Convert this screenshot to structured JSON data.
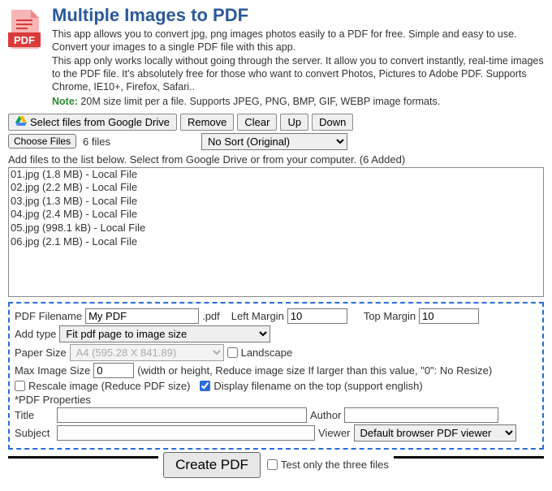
{
  "header": {
    "title": "Multiple Images to PDF",
    "desc1": "This app allows you to convert jpg, png images photos easily to a PDF for free. Simple and easy to use. Convert your images to a single PDF file with this app.",
    "desc2": "This app only works locally without going through the server. It allow you to convert instantly, real-time images to the PDF file. It's absolutely free for those who want to convert Photos, Pictures to Adobe PDF. Supports Chrome, IE10+, Firefox, Safari..",
    "note_label": "Note:",
    "note_text": " 20M size limit per a file. Supports JPEG, PNG, BMP, GIF, WEBP image formats."
  },
  "toolbar": {
    "gdrive": "Select files from Google Drive",
    "remove": "Remove",
    "clear": "Clear",
    "up": "Up",
    "down": "Down",
    "choose_files": "Choose Files",
    "file_count": "6 files",
    "sort_selected": "No Sort (Original)"
  },
  "instruction": "Add files to the list below. Select from Google Drive or from your computer. (6 Added)",
  "files": [
    "01.jpg (1.8 MB) - Local File",
    "02.jpg (2.2 MB) - Local File",
    "03.jpg (1.3 MB) - Local File",
    "04.jpg (2.4 MB) - Local File",
    "05.jpg (998.1 kB) - Local File",
    "06.jpg (2.1 MB) - Local File"
  ],
  "settings": {
    "filename_label": "PDF Filename",
    "filename_value": "My PDF",
    "ext": ".pdf",
    "left_margin_label": "Left Margin",
    "left_margin_value": "10",
    "top_margin_label": "Top Margin",
    "top_margin_value": "10",
    "addtype_label": "Add type",
    "addtype_value": "Fit pdf page to image size",
    "papersize_label": "Paper Size",
    "papersize_value": "A4 (595.28 X 841.89)",
    "landscape_label": "Landscape",
    "maxsize_label": "Max Image Size",
    "maxsize_value": "0",
    "maxsize_hint": "(width or height, Reduce image size If larger than this value, \"0\": No Resize)",
    "rescale_label": "Rescale image (Reduce PDF size)",
    "display_fname_label": "Display filename on the top (support english)",
    "props_label": "*PDF Properties",
    "title_label": "Title",
    "author_label": "Author",
    "subject_label": "Subject",
    "viewer_label": "Viewer",
    "viewer_value": "Default browser PDF viewer"
  },
  "footer": {
    "create": "Create PDF",
    "test_label": "Test only the three files"
  }
}
